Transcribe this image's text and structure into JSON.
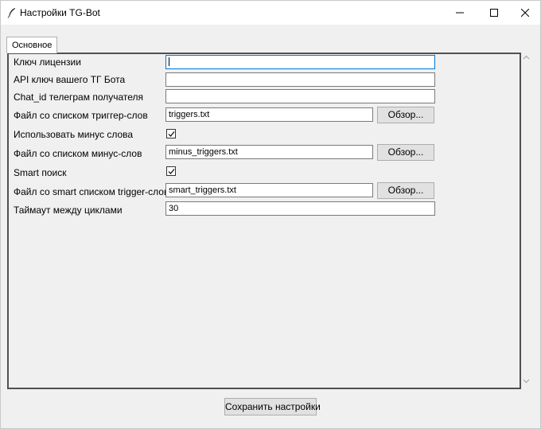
{
  "window": {
    "title": "Настройки TG-Bot"
  },
  "tabs": [
    {
      "label": "Основное",
      "selected": true
    }
  ],
  "form": {
    "license_key": {
      "label": "Ключ лицензии",
      "value": ""
    },
    "api_key": {
      "label": "API ключ вашего ТГ Бота",
      "value": ""
    },
    "chat_id": {
      "label": "Chat_id телеграм получателя",
      "value": ""
    },
    "triggers_file": {
      "label": "Файл со списком триггер-слов",
      "value": "triggers.txt",
      "browse_label": "Обзор..."
    },
    "use_minus": {
      "label": "Использовать минус слова",
      "checked": true
    },
    "minus_file": {
      "label": "Файл со списком минус-слов",
      "value": "minus_triggers.txt",
      "browse_label": "Обзор..."
    },
    "smart_search": {
      "label": "Smart поиск",
      "checked": true
    },
    "smart_file": {
      "label": "Файл со smart списком trigger-слов",
      "value": "smart_triggers.txt",
      "browse_label": "Обзор..."
    },
    "timeout": {
      "label": "Таймаут между циклами",
      "value": "30"
    }
  },
  "footer": {
    "save_label": "Сохранить настройки"
  },
  "colors": {
    "focus_border": "#0078d7",
    "panel_border": "#505050",
    "background": "#f0f0f0"
  }
}
